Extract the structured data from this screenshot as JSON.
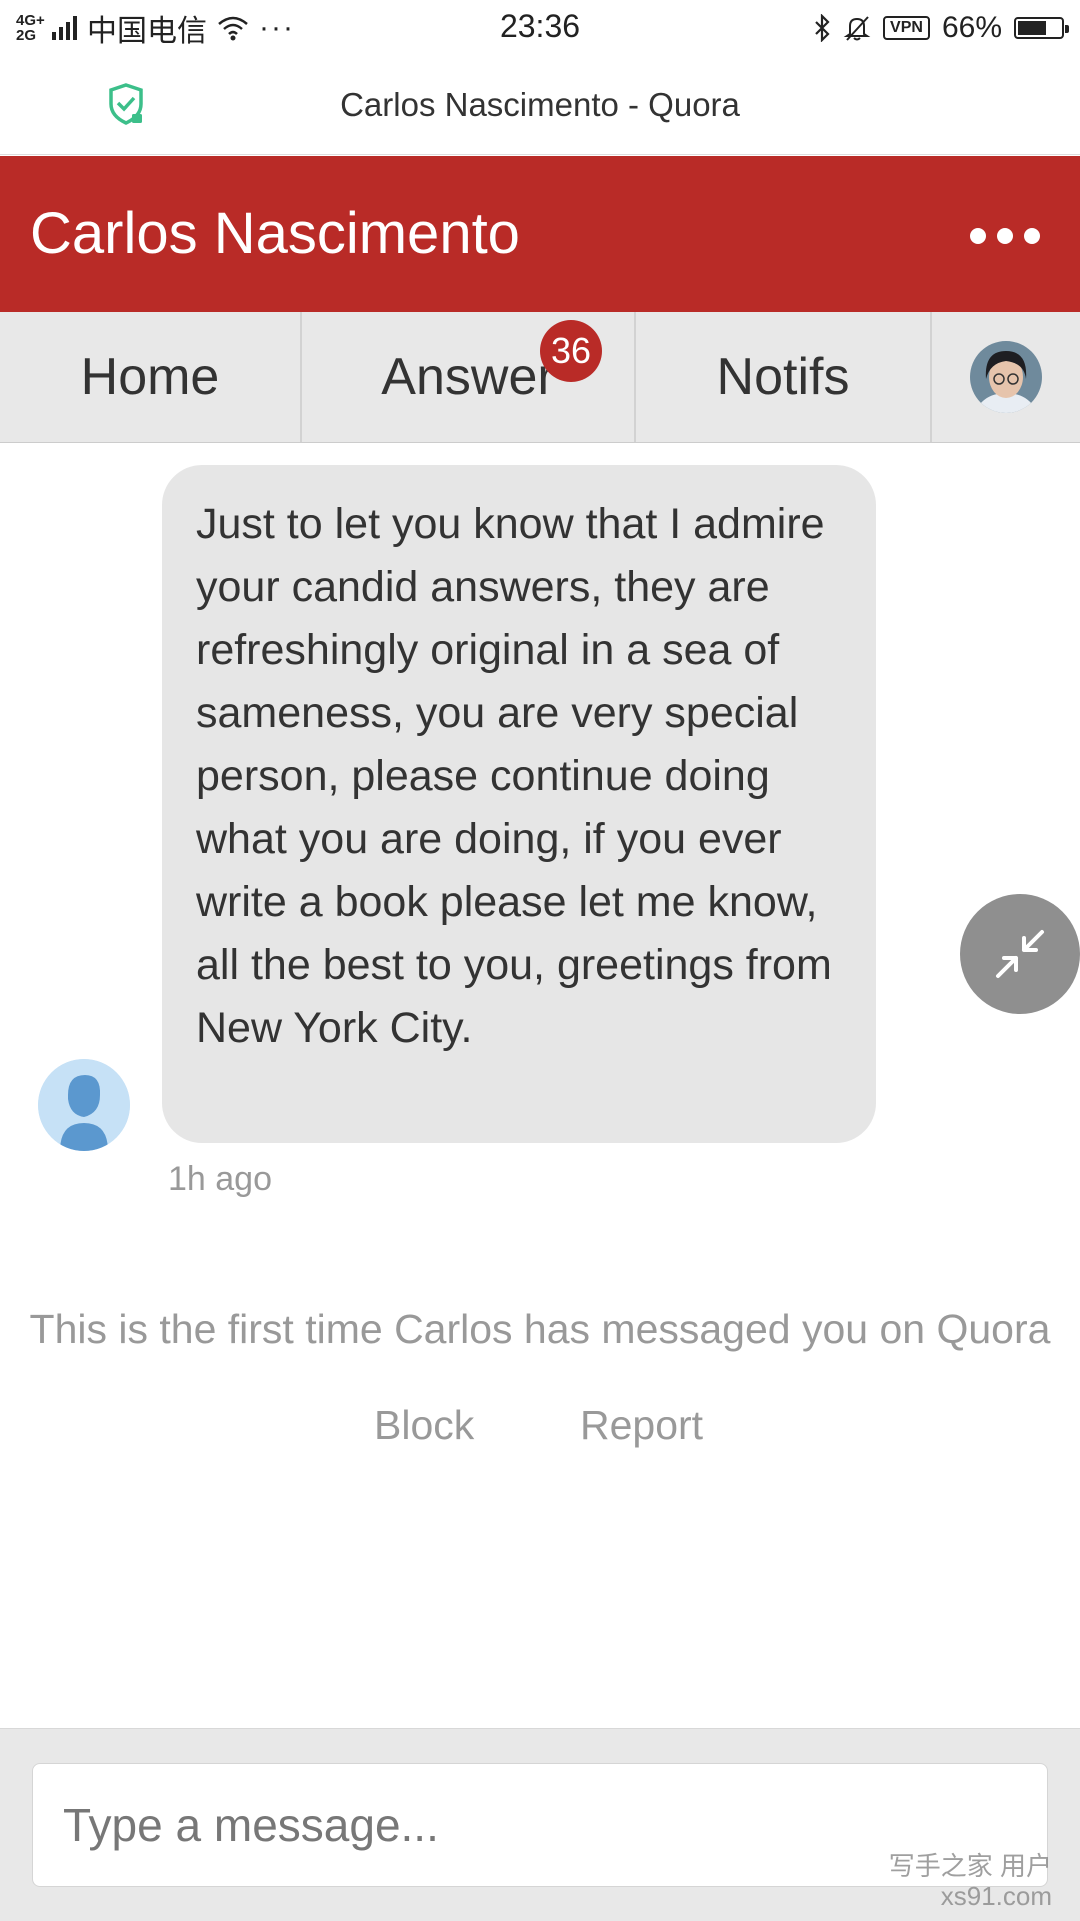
{
  "status_bar": {
    "network": "4G+ 2G",
    "carrier": "中国电信",
    "more_dots": "···",
    "time": "23:36",
    "vpn_label": "VPN",
    "battery_percent": "66%",
    "battery_level": 0.66
  },
  "browser": {
    "page_title": "Carlos Nascimento - Quora",
    "shield_color": "#3cbf8a"
  },
  "header": {
    "title": "Carlos Nascimento",
    "background_color": "#b92b27"
  },
  "tabs": [
    {
      "label": "Home"
    },
    {
      "label": "Answer",
      "badge": "36"
    },
    {
      "label": "Notifs"
    }
  ],
  "message": {
    "text": "Just to let you know that I admire your candid answers, they are refreshingly original in a sea of sameness, you are very special person, please continue doing what you are doing, if you ever write a book please let me know, all the best to you, greetings from New York City.",
    "timestamp": "1h ago"
  },
  "first_time_note": "This is the first time Carlos has messaged you on Quora",
  "actions": {
    "block": "Block",
    "report": "Report"
  },
  "composer": {
    "placeholder": "Type a message..."
  },
  "watermark": {
    "line1": "写手之家 用户",
    "line2": "xs91.com"
  }
}
